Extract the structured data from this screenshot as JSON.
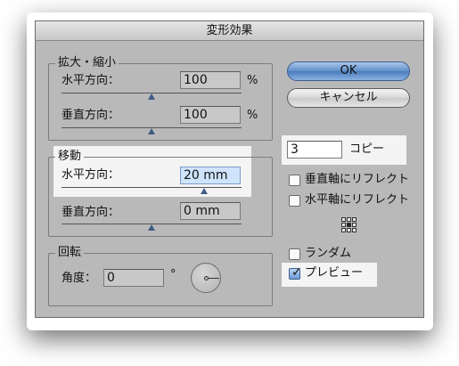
{
  "window": {
    "title": "変形効果"
  },
  "scale": {
    "legend": "拡大・縮小",
    "horizontal": {
      "label": "水平方向：",
      "value": "100",
      "unit": "%"
    },
    "vertical": {
      "label": "垂直方向：",
      "value": "100",
      "unit": "%"
    }
  },
  "move": {
    "legend": "移動",
    "horizontal": {
      "label": "水平方向：",
      "value": "20 mm"
    },
    "vertical": {
      "label": "垂直方向：",
      "value": "0 mm"
    }
  },
  "rotate": {
    "legend": "回転",
    "angle": {
      "label": "角度：",
      "value": "0",
      "unit": "°"
    }
  },
  "buttons": {
    "ok": "OK",
    "cancel": "キャンセル"
  },
  "copies": {
    "value": "3",
    "label": "コピー"
  },
  "options": {
    "reflect_vertical": {
      "label": "垂直軸にリフレクト",
      "checked": false
    },
    "reflect_horizontal": {
      "label": "水平軸にリフレクト",
      "checked": false
    },
    "random": {
      "label": "ランダム",
      "checked": false
    },
    "preview": {
      "label": "プレビュー",
      "checked": true
    }
  },
  "colors": {
    "dialog_bg": "#b9b9b9",
    "accent": "#5f8ec8",
    "highlight": "#f4f4f4"
  }
}
